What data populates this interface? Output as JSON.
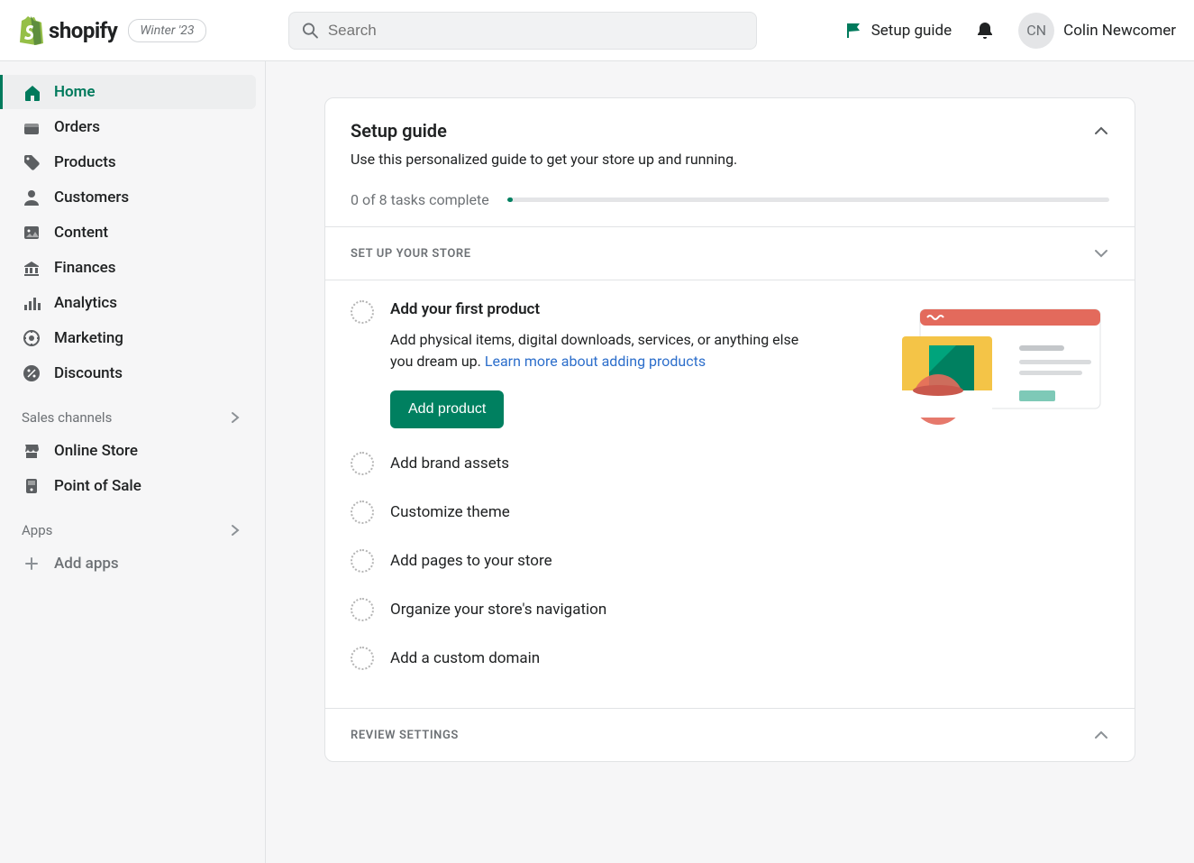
{
  "brand": {
    "name": "shopify",
    "badge": "Winter '23"
  },
  "search": {
    "placeholder": "Search"
  },
  "topbar": {
    "setup_guide": "Setup guide",
    "user_initials": "CN",
    "user_name": "Colin Newcomer"
  },
  "sidebar": {
    "nav": [
      {
        "label": "Home",
        "icon": "home",
        "active": true
      },
      {
        "label": "Orders",
        "icon": "inbox"
      },
      {
        "label": "Products",
        "icon": "tag"
      },
      {
        "label": "Customers",
        "icon": "person"
      },
      {
        "label": "Content",
        "icon": "image"
      },
      {
        "label": "Finances",
        "icon": "bank"
      },
      {
        "label": "Analytics",
        "icon": "bars"
      },
      {
        "label": "Marketing",
        "icon": "target"
      },
      {
        "label": "Discounts",
        "icon": "percent"
      }
    ],
    "sections": {
      "sales_channels": "Sales channels",
      "apps": "Apps"
    },
    "channels": [
      {
        "label": "Online Store",
        "icon": "store"
      },
      {
        "label": "Point of Sale",
        "icon": "pos"
      }
    ],
    "add_apps": "Add apps"
  },
  "setup_card": {
    "title": "Setup guide",
    "subtitle": "Use this personalized guide to get your store up and running.",
    "progress_text": "0 of 8 tasks complete",
    "progress_pct": 1,
    "sections": {
      "store": "SET UP YOUR STORE",
      "review": "REVIEW SETTINGS"
    },
    "tasks": [
      {
        "label": "Add your first product",
        "expanded": true,
        "desc": "Add physical items, digital downloads, services, or anything else you dream up. ",
        "link_text": "Learn more about adding products",
        "cta": "Add product"
      },
      {
        "label": "Add brand assets"
      },
      {
        "label": "Customize theme"
      },
      {
        "label": "Add pages to your store"
      },
      {
        "label": "Organize your store's navigation"
      },
      {
        "label": "Add a custom domain"
      }
    ]
  }
}
